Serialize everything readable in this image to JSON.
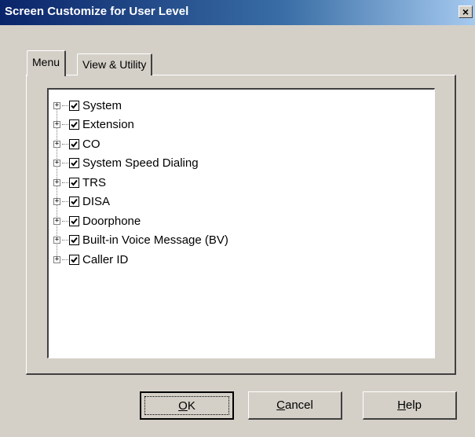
{
  "window": {
    "title": "Screen Customize for User Level",
    "close_label": "×"
  },
  "tabs": [
    {
      "label": "Menu",
      "selected": true
    },
    {
      "label": "View & Utility",
      "selected": false
    }
  ],
  "tree": {
    "items": [
      {
        "label": "System",
        "checked": true,
        "expander": "+"
      },
      {
        "label": "Extension",
        "checked": true,
        "expander": "+"
      },
      {
        "label": "CO",
        "checked": true,
        "expander": "+"
      },
      {
        "label": "System Speed Dialing",
        "checked": true,
        "expander": "+"
      },
      {
        "label": "TRS",
        "checked": true,
        "expander": "+"
      },
      {
        "label": "DISA",
        "checked": true,
        "expander": "+"
      },
      {
        "label": "Doorphone",
        "checked": true,
        "expander": "+"
      },
      {
        "label": "Built-in Voice Message (BV)",
        "checked": true,
        "expander": "+"
      },
      {
        "label": "Caller ID",
        "checked": true,
        "expander": "+"
      }
    ]
  },
  "buttons": {
    "ok": {
      "mnemonic": "O",
      "rest": "K"
    },
    "cancel": {
      "mnemonic": "C",
      "rest": "ancel"
    },
    "help": {
      "mnemonic": "H",
      "rest": "elp"
    }
  },
  "icons": {
    "checkbox": "checkmark-icon",
    "expander": "plus-icon",
    "close": "close-icon"
  },
  "colors": {
    "titlebar_start": "#0a246a",
    "titlebar_end": "#a6caf0",
    "face": "#d4d0c8"
  }
}
